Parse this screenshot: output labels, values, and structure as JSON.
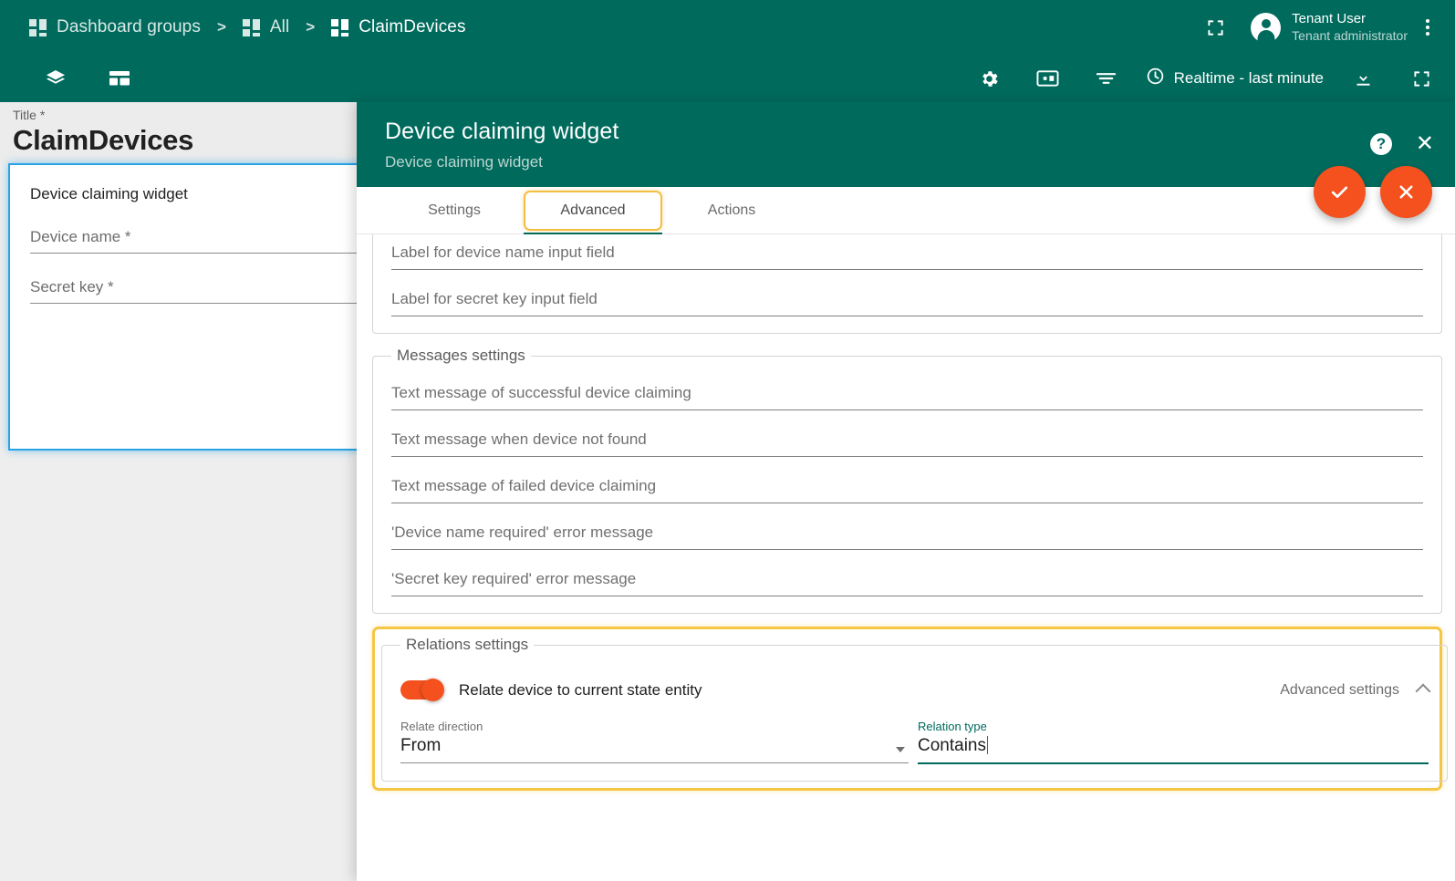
{
  "topbar": {
    "breadcrumbs": [
      {
        "label": "Dashboard groups",
        "icon": "dashboard-grid-icon"
      },
      {
        "label": "All",
        "icon": "dashboard-grid-icon"
      },
      {
        "label": "ClaimDevices",
        "icon": "dashboard-grid-icon"
      }
    ],
    "separator": ">",
    "fullscreen_icon": "fullscreen-icon",
    "user": {
      "name": "Tenant User",
      "role": "Tenant administrator",
      "avatar_icon": "user-avatar-icon"
    },
    "more_icon": "kebab-menu-icon"
  },
  "toolbar": {
    "layers_icon": "layers-icon",
    "layout_icon": "dashboard-layout-icon",
    "settings_icon": "gear-icon",
    "states_icon": "device-states-icon",
    "filter_icon": "filter-icon",
    "clock_icon": "clock-icon",
    "timewindow_label": "Realtime - last minute",
    "download_icon": "download-icon",
    "expand_icon": "fullscreen-icon"
  },
  "dashboard": {
    "title_label": "Title *",
    "title_value": "ClaimDevices",
    "widget": {
      "title": "Device claiming widget",
      "fields": [
        {
          "label": "Device name *"
        },
        {
          "label": "Secret key *"
        }
      ]
    }
  },
  "dialog": {
    "title": "Device claiming widget",
    "subtitle": "Device claiming widget",
    "help_icon": "help-icon",
    "help_label": "?",
    "close_icon": "close-icon",
    "apply_icon": "check-icon",
    "cancel_icon": "close-icon",
    "tabs": [
      {
        "label": "Settings",
        "selected": false
      },
      {
        "label": "Advanced",
        "selected": true
      },
      {
        "label": "Actions",
        "selected": false
      }
    ],
    "labels_section": {
      "fields": [
        {
          "placeholder": "Label for device name input field"
        },
        {
          "placeholder": "Label for secret key input field"
        }
      ]
    },
    "messages_section": {
      "legend": "Messages settings",
      "fields": [
        {
          "placeholder": "Text message of successful device claiming"
        },
        {
          "placeholder": "Text message when device not found"
        },
        {
          "placeholder": "Text message of failed device claiming"
        },
        {
          "placeholder": "'Device name required' error message"
        },
        {
          "placeholder": "'Secret key required' error message"
        }
      ]
    },
    "relations_section": {
      "legend": "Relations settings",
      "toggle_label": "Relate device to current state entity",
      "toggle_on": true,
      "advanced_settings_label": "Advanced settings",
      "chevron_icon": "chevron-up-icon",
      "relate_direction": {
        "label": "Relate direction",
        "value": "From",
        "dropdown_icon": "chevron-down-icon"
      },
      "relation_type": {
        "label": "Relation type",
        "value": "Contains",
        "focused": true
      }
    }
  },
  "colors": {
    "primary_teal": "#006b5d",
    "accent_orange": "#f4511e",
    "highlight_yellow": "#f5c644",
    "selection_blue": "#29a3e3",
    "page_bg": "#eeeeee"
  }
}
